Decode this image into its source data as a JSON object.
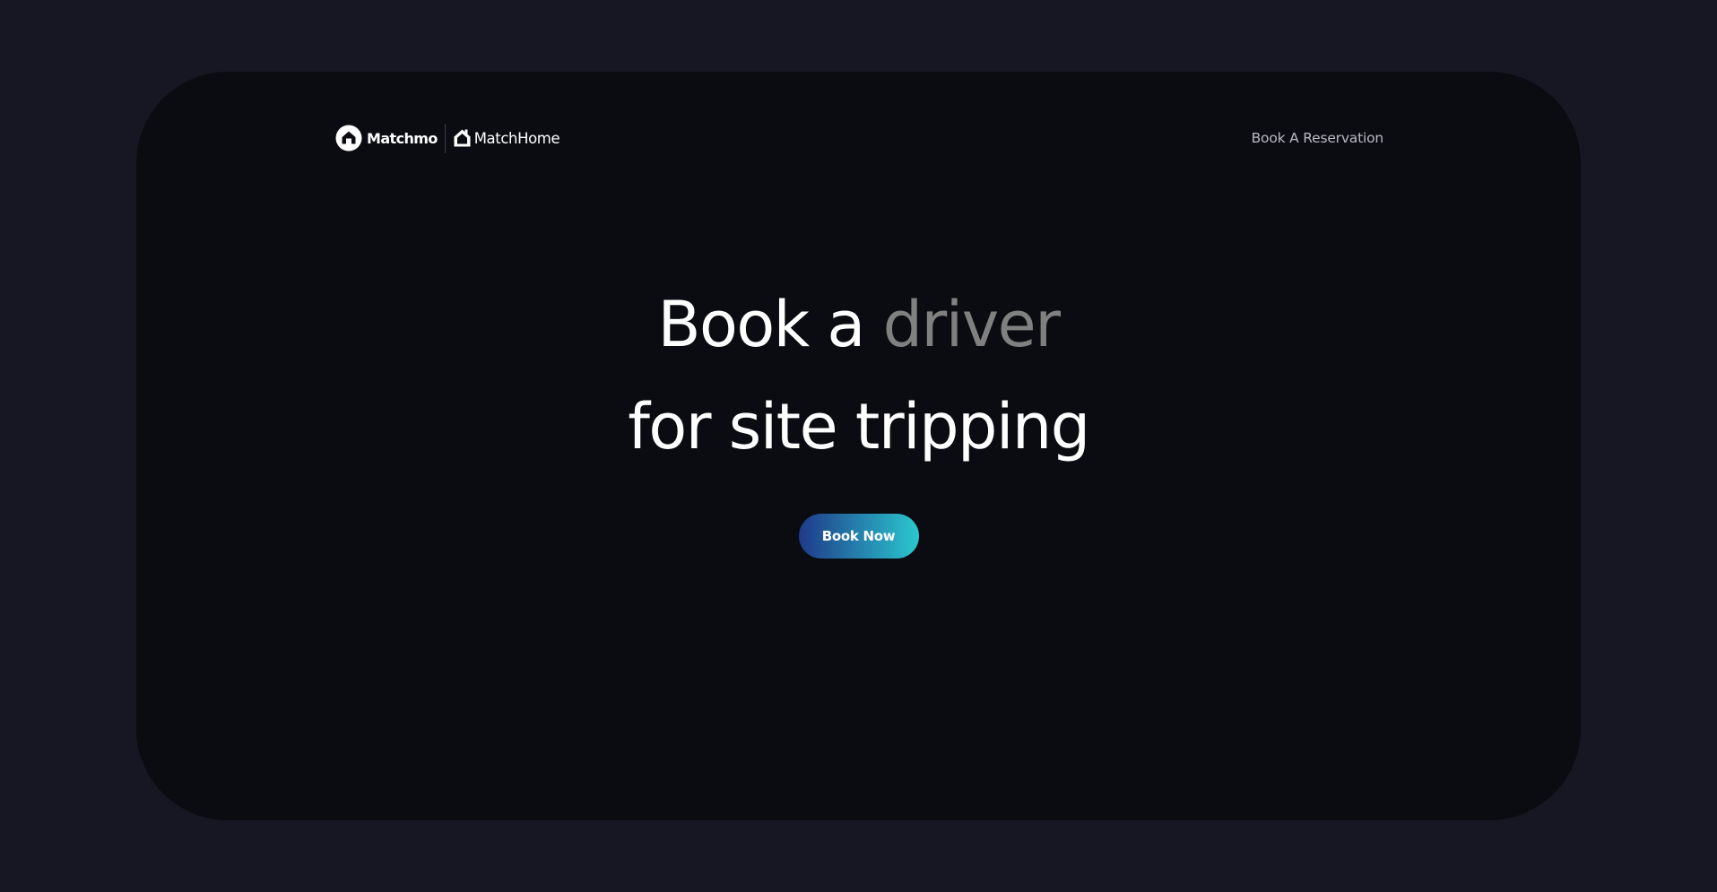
{
  "nav": {
    "brand_primary": "Matchmo",
    "brand_secondary": "MatchHome",
    "link_reservation": "Book A Reservation"
  },
  "hero": {
    "headline_prefix": "Book a ",
    "headline_accent": "driver",
    "headline_line2": "for site tripping",
    "cta_label": "Book Now"
  },
  "colors": {
    "page_background": "#161722",
    "card_background": "#0b0c11",
    "headline_text": "#ffffff",
    "headline_accent": "#808080",
    "nav_link": "#b9bbc3",
    "cta_gradient_start": "#1f3a8a",
    "cta_gradient_end": "#2bc7cf"
  },
  "icons": {
    "matchmo_logo": "house-in-circle-icon",
    "matchhome_logo": "house-outline-icon"
  }
}
